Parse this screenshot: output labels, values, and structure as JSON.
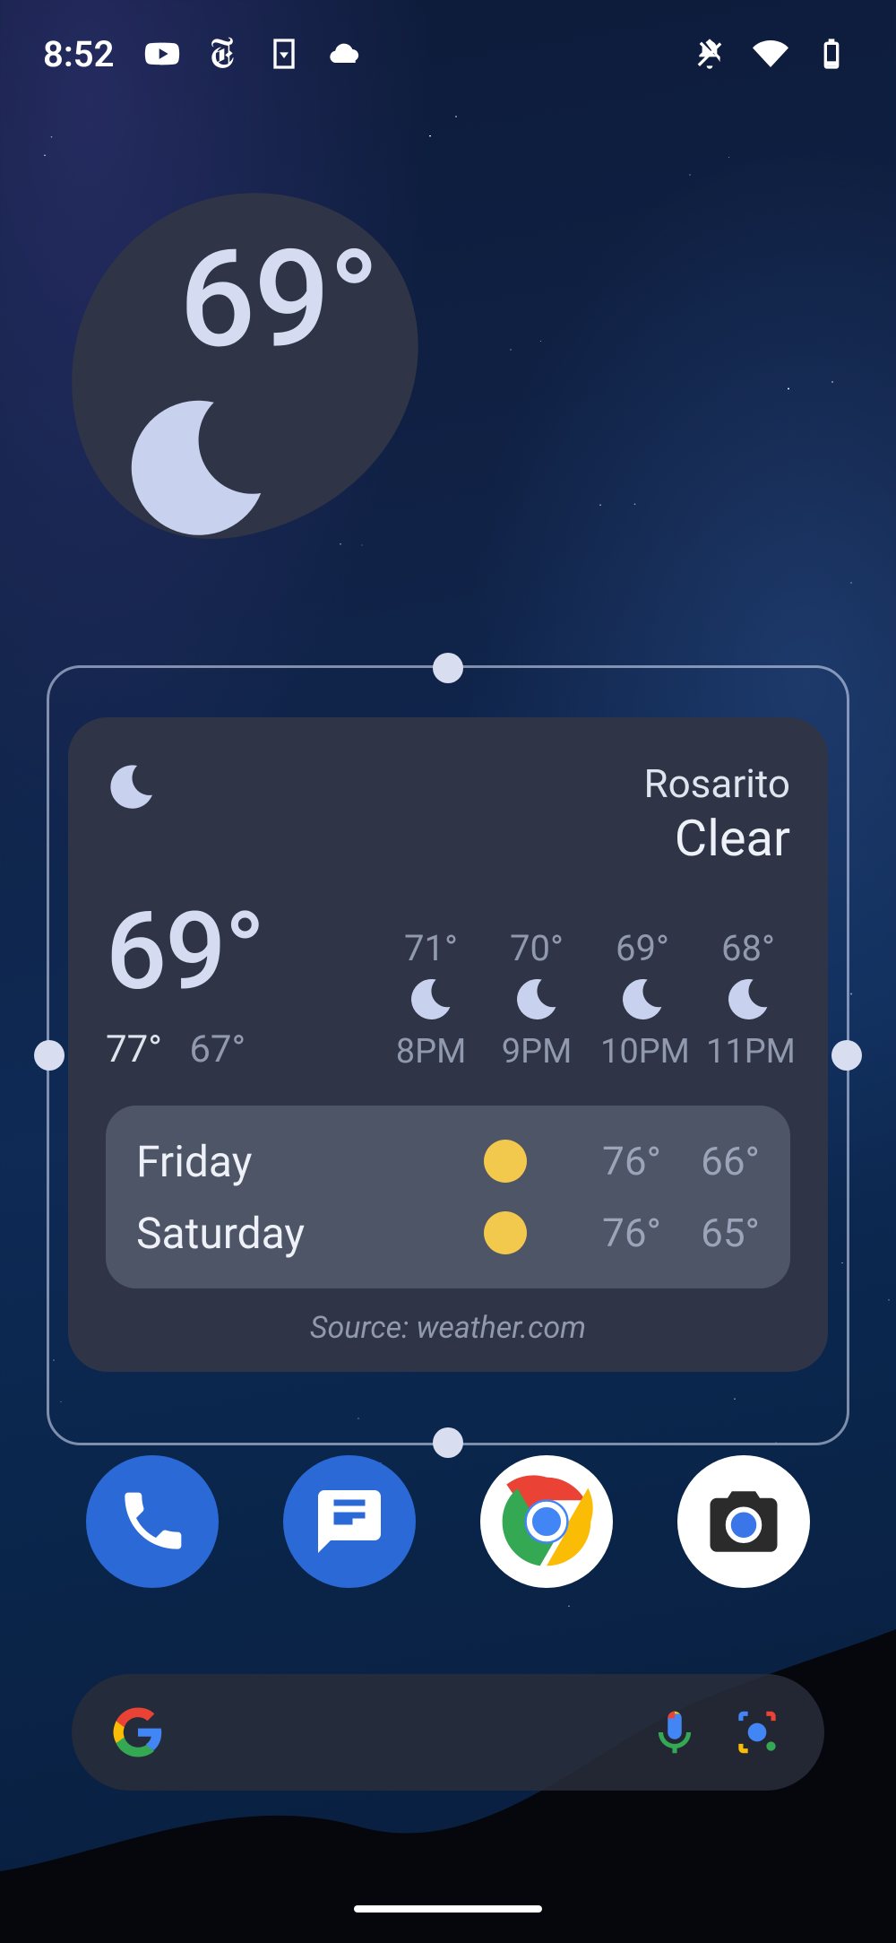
{
  "statusbar": {
    "time": "8:52",
    "icons_left": [
      "youtube-icon",
      "nyt-icon",
      "download-icon",
      "cloud-icon"
    ],
    "icons_right": [
      "dnd-icon",
      "wifi-icon",
      "battery-icon"
    ]
  },
  "weather_small": {
    "temperature": "69°",
    "condition_icon": "moon-icon"
  },
  "weather_large": {
    "condition_icon": "moon-icon",
    "location": "Rosarito",
    "condition": "Clear",
    "temperature": "69°",
    "high": "77°",
    "low": "67°",
    "hourly": [
      {
        "temp": "71°",
        "icon": "moon-icon",
        "time": "8PM"
      },
      {
        "temp": "70°",
        "icon": "moon-icon",
        "time": "9PM"
      },
      {
        "temp": "69°",
        "icon": "moon-icon",
        "time": "10PM"
      },
      {
        "temp": "68°",
        "icon": "moon-icon",
        "time": "11PM"
      }
    ],
    "daily": [
      {
        "day": "Friday",
        "icon": "sun-icon",
        "high": "76°",
        "low": "66°"
      },
      {
        "day": "Saturday",
        "icon": "sun-icon",
        "high": "76°",
        "low": "65°"
      }
    ],
    "source": "Source: weather.com"
  },
  "dock": {
    "apps": [
      {
        "name": "phone-app",
        "icon": "phone-icon"
      },
      {
        "name": "messages-app",
        "icon": "messages-icon"
      },
      {
        "name": "chrome-app",
        "icon": "chrome-icon"
      },
      {
        "name": "camera-app",
        "icon": "camera-icon"
      }
    ]
  },
  "searchbar": {
    "logo": "google-g-icon",
    "mic": "mic-icon",
    "lens": "lens-icon"
  }
}
